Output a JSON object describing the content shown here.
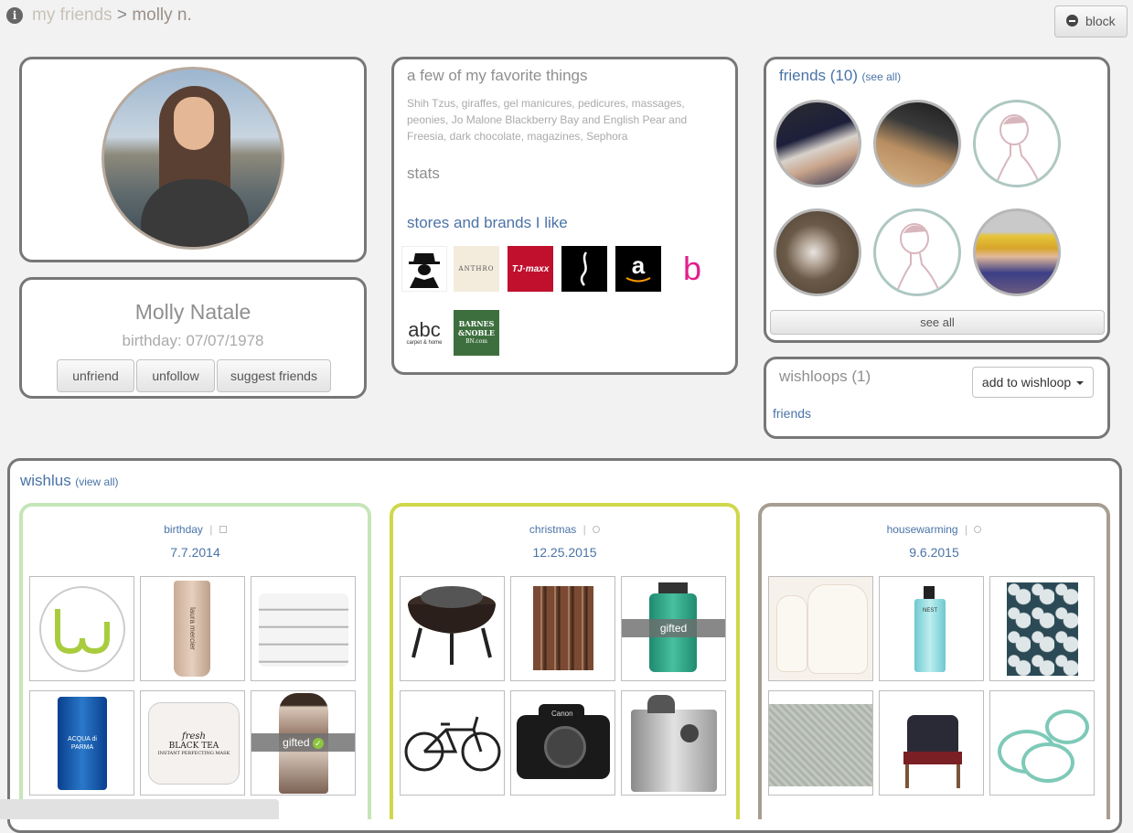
{
  "breadcrumb": {
    "root": "my friends",
    "separator": ">",
    "current": "molly n."
  },
  "header": {
    "block_label": "block",
    "info_icon": "info-icon",
    "block_icon": "minus-circle-icon"
  },
  "profile": {
    "name": "Molly Natale",
    "birthday": "birthday: 07/07/1978",
    "buttons": {
      "unfriend": "unfriend",
      "unfollow": "unfollow",
      "suggest": "suggest friends"
    }
  },
  "favorites": {
    "title": "a few of my favorite things",
    "text": "Shih Tzus, giraffes, gel manicures, pedicures, massages, peonies, Jo Malone Blackberry Bay and English Pear and Freesia, dark chocolate, magazines, Sephora",
    "stats_title": "stats",
    "stores_title": "stores and brands I like",
    "logos": {
      "anthro": "ANTHRO",
      "tjmaxx": "TJ·maxx",
      "amazon": "a",
      "b": "b",
      "abc": "abc",
      "abc_sub": "carpet & home",
      "bn1": "BARNES",
      "bn2": "&NOBLE",
      "bn3": "BN.com"
    }
  },
  "friends": {
    "title": "friends (10)",
    "see_all_link": "(see all)",
    "see_all_button": "see all"
  },
  "wishloops": {
    "title": "wishloops (1)",
    "add_button": "add to wishloop",
    "items": [
      "friends"
    ]
  },
  "wishlists": {
    "title": "wishlus",
    "view_all": "(view all)",
    "lists": [
      {
        "name": "birthday",
        "sep": "|",
        "date": "7.7.2014",
        "color": "#c5e6b8"
      },
      {
        "name": "christmas",
        "sep": "|",
        "date": "12.25.2015",
        "color": "#cfd84a"
      },
      {
        "name": "housewarming",
        "sep": "|",
        "date": "9.6.2015",
        "color": "#a79e91"
      }
    ],
    "gifted_label": "gifted",
    "product_labels": {
      "laura": "laura mercier",
      "acqua": "ACQUA di PARMA",
      "fresh1": "fresh",
      "fresh2": "BLACK TEA",
      "fresh3": "INSTANT PERFECTING MASK",
      "nest": "NEST",
      "canon": "Canon"
    }
  }
}
